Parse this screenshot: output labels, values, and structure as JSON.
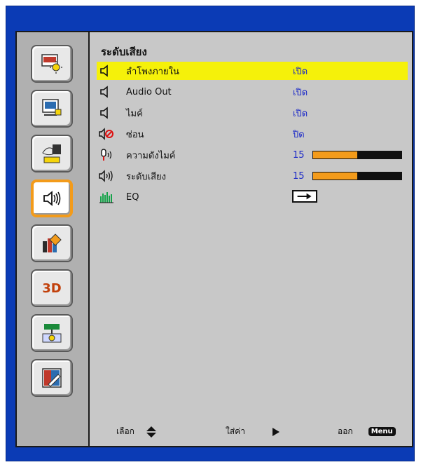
{
  "menu": {
    "title": "ระดับเสียง",
    "items": [
      {
        "label": "ลำโพงภายใน",
        "value": "เปิด",
        "icon": "speaker-icon",
        "selected": true
      },
      {
        "label": "Audio Out",
        "value": "เปิด",
        "icon": "speaker-icon",
        "selected": false
      },
      {
        "label": "ไมค์",
        "value": "เปิด",
        "icon": "speaker-icon",
        "selected": false
      },
      {
        "label": "ซ่อน",
        "value": "ปิด",
        "icon": "mute-icon",
        "selected": false
      },
      {
        "label": "ความดังไมค์",
        "value": "15",
        "icon": "microphone-icon",
        "level": 0.5,
        "selected": false
      },
      {
        "label": "ระดับเสียง",
        "value": "15",
        "icon": "volume-icon",
        "level": 0.5,
        "selected": false
      },
      {
        "label": "EQ",
        "icon": "equalizer-icon",
        "selected": false
      }
    ]
  },
  "sidebar": [
    {
      "name": "image-settings",
      "icon": "screen-brightness-icon"
    },
    {
      "name": "display-settings",
      "icon": "projector-screen-icon"
    },
    {
      "name": "setup",
      "icon": "hand-settings-icon"
    },
    {
      "name": "audio",
      "icon": "audio-speaker-icon",
      "active": true
    },
    {
      "name": "options",
      "icon": "options-icon"
    },
    {
      "name": "3d",
      "label": "3D"
    },
    {
      "name": "network",
      "icon": "network-icon"
    },
    {
      "name": "interactive",
      "icon": "pen-board-icon"
    }
  ],
  "footer": {
    "select_label": "เลือก",
    "enter_label": "ใส่ค่า",
    "exit_label": "ออก",
    "menu_key": "Menu"
  },
  "colors": {
    "frame": "#0b3bb5",
    "highlight": "#f5f10a",
    "accent": "#f39b1a",
    "value_text": "#1a28c8"
  }
}
